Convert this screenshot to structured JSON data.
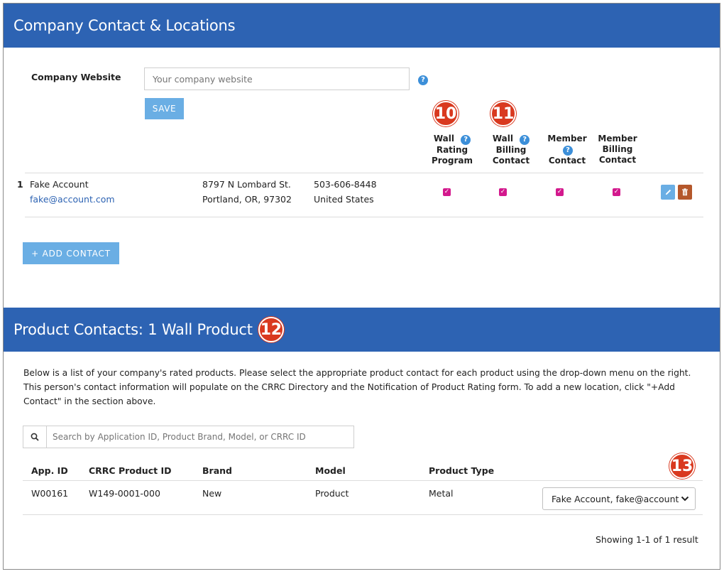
{
  "locations": {
    "title": "Company Contact & Locations",
    "website_label": "Company Website",
    "website_placeholder": "Your company website",
    "save_label": "SAVE",
    "columns": [
      "Wall Rating Program",
      "Wall Billing Contact",
      "Member Contact",
      "Member Billing Contact"
    ],
    "col_lines": {
      "c1": [
        "Wall",
        "Rating",
        "Program"
      ],
      "c2": [
        "Wall",
        "Billing",
        "Contact"
      ],
      "c3": [
        "Member",
        "Contact"
      ],
      "c4": [
        "Member",
        "Billing",
        "Contact"
      ]
    },
    "badges": {
      "b10": "10",
      "b11": "11"
    },
    "contact": {
      "index": "1",
      "name": "Fake Account",
      "email": "fake@account.com",
      "address_line1": "8797 N Lombard St.",
      "address_line2": "Portland, OR, 97302",
      "phone": "503-606-8448",
      "country": "United States",
      "checks": [
        true,
        true,
        true,
        true
      ]
    },
    "add_contact_label": "+ ADD CONTACT"
  },
  "products": {
    "title": "Product Contacts: 1 Wall Product",
    "badge": "12",
    "description": "Below is a list of your company's rated products. Please select the appropriate product contact for each product using the drop-down menu on the right. This person's contact information will populate on the CRRC Directory and the Notification of Product Rating form. To add a new location, click \"+Add Contact\" in the section above.",
    "search_placeholder": "Search by Application ID, Product Brand, Model, or CRRC ID",
    "badge_select": "13",
    "headers": {
      "app_id": "App. ID",
      "crrc_id": "CRRC Product ID",
      "brand": "Brand",
      "model": "Model",
      "type": "Product Type"
    },
    "rows": [
      {
        "app_id": "W00161",
        "crrc_id": "W149-0001-000",
        "brand": "New",
        "model": "Product",
        "type": "Metal",
        "contact": "Fake Account, fake@account"
      }
    ],
    "result_text": "Showing 1-1 of 1 result"
  },
  "colors": {
    "header_blue": "#2d63b3",
    "badge_red": "#d9391f",
    "check_magenta": "#d3198d",
    "button_blue": "#6aaee4",
    "delete_brown": "#b4572b"
  }
}
